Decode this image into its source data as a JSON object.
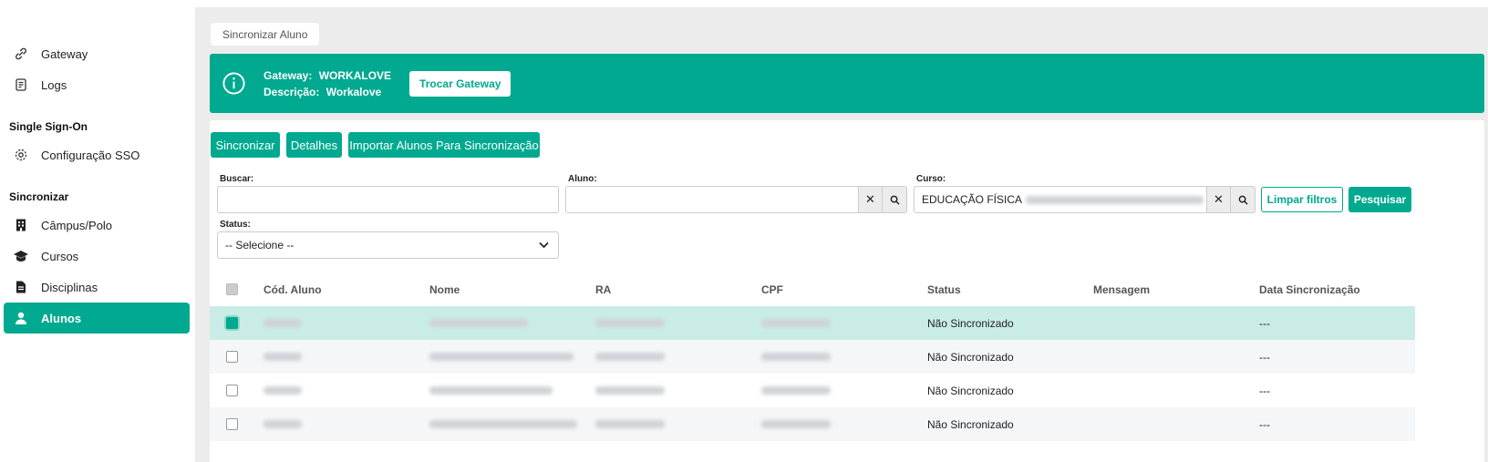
{
  "sidebar": {
    "items_top": [
      {
        "label": "Gateway",
        "icon": "link-icon"
      },
      {
        "label": "Logs",
        "icon": "scroll-icon"
      }
    ],
    "section_sso": "Single Sign-On",
    "sso_items": [
      {
        "label": "Configuração SSO",
        "icon": "gear-icon"
      }
    ],
    "section_sync": "Sincronizar",
    "sync_items": [
      {
        "label": "Câmpus/Polo",
        "icon": "building-icon"
      },
      {
        "label": "Cursos",
        "icon": "graduation-cap-icon"
      },
      {
        "label": "Disciplinas",
        "icon": "file-icon"
      },
      {
        "label": "Alunos",
        "icon": "user-icon",
        "active": true
      }
    ]
  },
  "breadcrumb": "Sincronizar Aluno",
  "banner": {
    "gateway_key": "Gateway:",
    "gateway_value": "WORKALOVE",
    "desc_key": "Descrição:",
    "desc_value": "Workalove",
    "swap_button": "Trocar Gateway"
  },
  "actions": {
    "sync": "Sincronizar",
    "details": "Detalhes",
    "import": "Importar Alunos Para Sincronização"
  },
  "filters": {
    "search_label": "Buscar:",
    "search_value": "",
    "student_label": "Aluno:",
    "student_value": "",
    "course_label": "Curso:",
    "course_value": "EDUCAÇÃO FÍSICA",
    "clear_button": "Limpar filtros",
    "search_button": "Pesquisar",
    "status_label": "Status:",
    "status_selected": "-- Selecione --"
  },
  "table": {
    "headers": [
      "Cód. Aluno",
      "Nome",
      "RA",
      "CPF",
      "Status",
      "Mensagem",
      "Data Sincronização"
    ],
    "rows": [
      {
        "status": "Não Sincronizado",
        "message": "",
        "date": "---",
        "checked": true
      },
      {
        "status": "Não Sincronizado",
        "message": "",
        "date": "---",
        "checked": false
      },
      {
        "status": "Não Sincronizado",
        "message": "",
        "date": "---",
        "checked": false
      },
      {
        "status": "Não Sincronizado",
        "message": "",
        "date": "---",
        "checked": false
      }
    ]
  },
  "colors": {
    "accent": "#00a98f",
    "selected_row": "#c9ede6"
  }
}
